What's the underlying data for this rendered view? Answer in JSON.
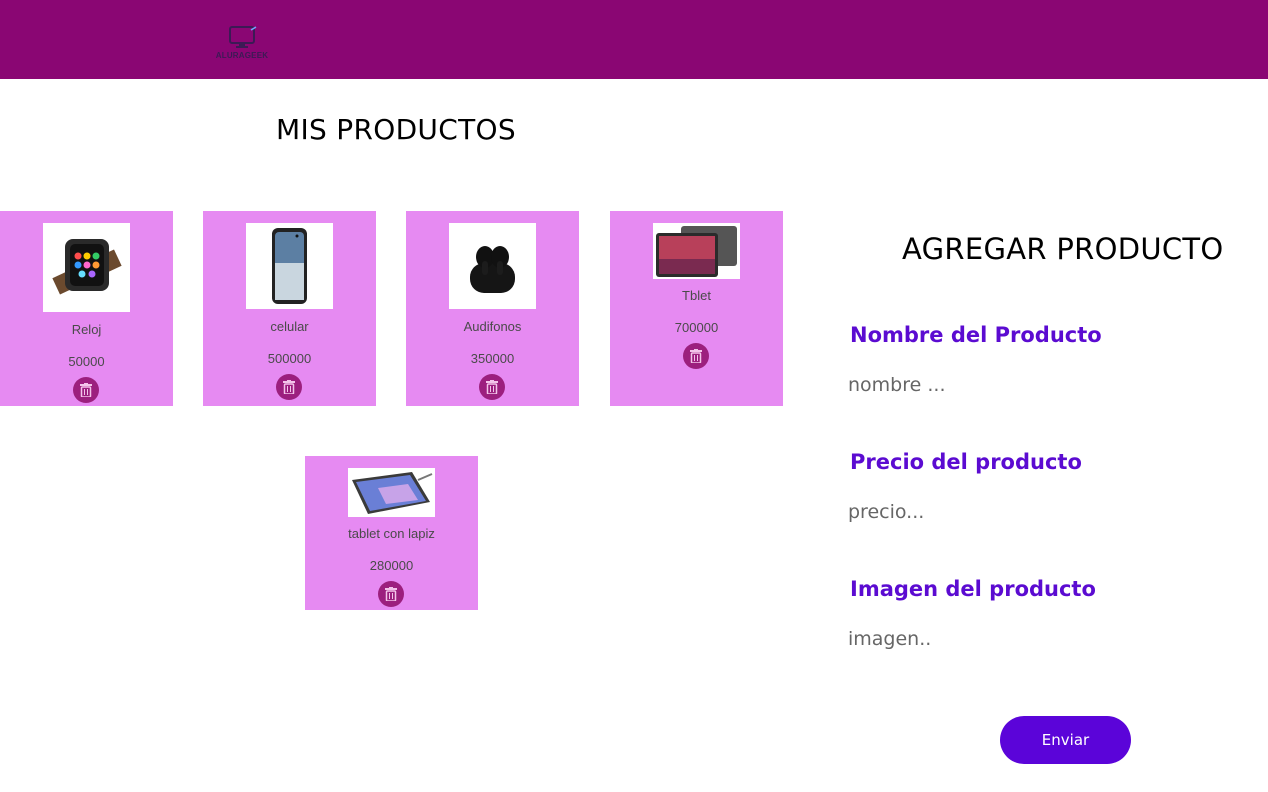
{
  "header": {
    "logo_text": "ALURAGEEK",
    "background": "#8a0673",
    "logo_icon": "monitor-icon"
  },
  "products": {
    "title": "MIS PRODUCTOS",
    "card_color": "#e68af2",
    "delete_icon": "trash-icon",
    "items": [
      {
        "name": "Reloj",
        "price": "50000",
        "image": "smartwatch"
      },
      {
        "name": "celular",
        "price": "500000",
        "image": "phone"
      },
      {
        "name": "Audifonos",
        "price": "350000",
        "image": "earbuds"
      },
      {
        "name": "Tblet",
        "price": "700000",
        "image": "tablet"
      },
      {
        "name": "tablet con lapiz",
        "price": "280000",
        "image": "tablet-with-pen"
      }
    ]
  },
  "form": {
    "title": "AGREGAR PRODUCTO",
    "name_label": "Nombre del Producto",
    "name_placeholder": "nombre ...",
    "price_label": "Precio del producto",
    "price_placeholder": "precio...",
    "image_label": "Imagen del producto",
    "image_placeholder": "imagen..",
    "submit_label": "Enviar",
    "accent": "#5b0bd1"
  }
}
